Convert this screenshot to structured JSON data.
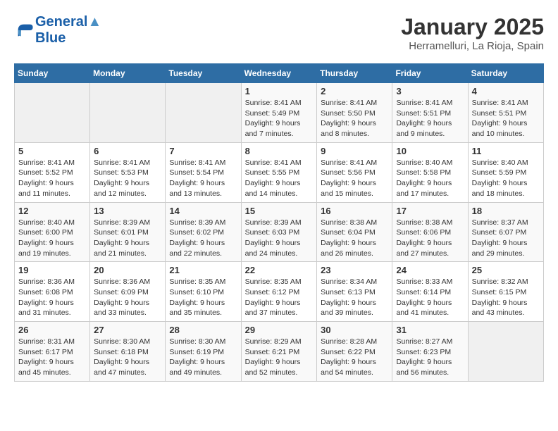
{
  "header": {
    "logo_line1": "General",
    "logo_line2": "Blue",
    "month": "January 2025",
    "location": "Herramelluri, La Rioja, Spain"
  },
  "weekdays": [
    "Sunday",
    "Monday",
    "Tuesday",
    "Wednesday",
    "Thursday",
    "Friday",
    "Saturday"
  ],
  "weeks": [
    [
      {
        "day": "",
        "info": ""
      },
      {
        "day": "",
        "info": ""
      },
      {
        "day": "",
        "info": ""
      },
      {
        "day": "1",
        "info": "Sunrise: 8:41 AM\nSunset: 5:49 PM\nDaylight: 9 hours\nand 7 minutes."
      },
      {
        "day": "2",
        "info": "Sunrise: 8:41 AM\nSunset: 5:50 PM\nDaylight: 9 hours\nand 8 minutes."
      },
      {
        "day": "3",
        "info": "Sunrise: 8:41 AM\nSunset: 5:51 PM\nDaylight: 9 hours\nand 9 minutes."
      },
      {
        "day": "4",
        "info": "Sunrise: 8:41 AM\nSunset: 5:51 PM\nDaylight: 9 hours\nand 10 minutes."
      }
    ],
    [
      {
        "day": "5",
        "info": "Sunrise: 8:41 AM\nSunset: 5:52 PM\nDaylight: 9 hours\nand 11 minutes."
      },
      {
        "day": "6",
        "info": "Sunrise: 8:41 AM\nSunset: 5:53 PM\nDaylight: 9 hours\nand 12 minutes."
      },
      {
        "day": "7",
        "info": "Sunrise: 8:41 AM\nSunset: 5:54 PM\nDaylight: 9 hours\nand 13 minutes."
      },
      {
        "day": "8",
        "info": "Sunrise: 8:41 AM\nSunset: 5:55 PM\nDaylight: 9 hours\nand 14 minutes."
      },
      {
        "day": "9",
        "info": "Sunrise: 8:41 AM\nSunset: 5:56 PM\nDaylight: 9 hours\nand 15 minutes."
      },
      {
        "day": "10",
        "info": "Sunrise: 8:40 AM\nSunset: 5:58 PM\nDaylight: 9 hours\nand 17 minutes."
      },
      {
        "day": "11",
        "info": "Sunrise: 8:40 AM\nSunset: 5:59 PM\nDaylight: 9 hours\nand 18 minutes."
      }
    ],
    [
      {
        "day": "12",
        "info": "Sunrise: 8:40 AM\nSunset: 6:00 PM\nDaylight: 9 hours\nand 19 minutes."
      },
      {
        "day": "13",
        "info": "Sunrise: 8:39 AM\nSunset: 6:01 PM\nDaylight: 9 hours\nand 21 minutes."
      },
      {
        "day": "14",
        "info": "Sunrise: 8:39 AM\nSunset: 6:02 PM\nDaylight: 9 hours\nand 22 minutes."
      },
      {
        "day": "15",
        "info": "Sunrise: 8:39 AM\nSunset: 6:03 PM\nDaylight: 9 hours\nand 24 minutes."
      },
      {
        "day": "16",
        "info": "Sunrise: 8:38 AM\nSunset: 6:04 PM\nDaylight: 9 hours\nand 26 minutes."
      },
      {
        "day": "17",
        "info": "Sunrise: 8:38 AM\nSunset: 6:06 PM\nDaylight: 9 hours\nand 27 minutes."
      },
      {
        "day": "18",
        "info": "Sunrise: 8:37 AM\nSunset: 6:07 PM\nDaylight: 9 hours\nand 29 minutes."
      }
    ],
    [
      {
        "day": "19",
        "info": "Sunrise: 8:36 AM\nSunset: 6:08 PM\nDaylight: 9 hours\nand 31 minutes."
      },
      {
        "day": "20",
        "info": "Sunrise: 8:36 AM\nSunset: 6:09 PM\nDaylight: 9 hours\nand 33 minutes."
      },
      {
        "day": "21",
        "info": "Sunrise: 8:35 AM\nSunset: 6:10 PM\nDaylight: 9 hours\nand 35 minutes."
      },
      {
        "day": "22",
        "info": "Sunrise: 8:35 AM\nSunset: 6:12 PM\nDaylight: 9 hours\nand 37 minutes."
      },
      {
        "day": "23",
        "info": "Sunrise: 8:34 AM\nSunset: 6:13 PM\nDaylight: 9 hours\nand 39 minutes."
      },
      {
        "day": "24",
        "info": "Sunrise: 8:33 AM\nSunset: 6:14 PM\nDaylight: 9 hours\nand 41 minutes."
      },
      {
        "day": "25",
        "info": "Sunrise: 8:32 AM\nSunset: 6:15 PM\nDaylight: 9 hours\nand 43 minutes."
      }
    ],
    [
      {
        "day": "26",
        "info": "Sunrise: 8:31 AM\nSunset: 6:17 PM\nDaylight: 9 hours\nand 45 minutes."
      },
      {
        "day": "27",
        "info": "Sunrise: 8:30 AM\nSunset: 6:18 PM\nDaylight: 9 hours\nand 47 minutes."
      },
      {
        "day": "28",
        "info": "Sunrise: 8:30 AM\nSunset: 6:19 PM\nDaylight: 9 hours\nand 49 minutes."
      },
      {
        "day": "29",
        "info": "Sunrise: 8:29 AM\nSunset: 6:21 PM\nDaylight: 9 hours\nand 52 minutes."
      },
      {
        "day": "30",
        "info": "Sunrise: 8:28 AM\nSunset: 6:22 PM\nDaylight: 9 hours\nand 54 minutes."
      },
      {
        "day": "31",
        "info": "Sunrise: 8:27 AM\nSunset: 6:23 PM\nDaylight: 9 hours\nand 56 minutes."
      },
      {
        "day": "",
        "info": ""
      }
    ]
  ]
}
